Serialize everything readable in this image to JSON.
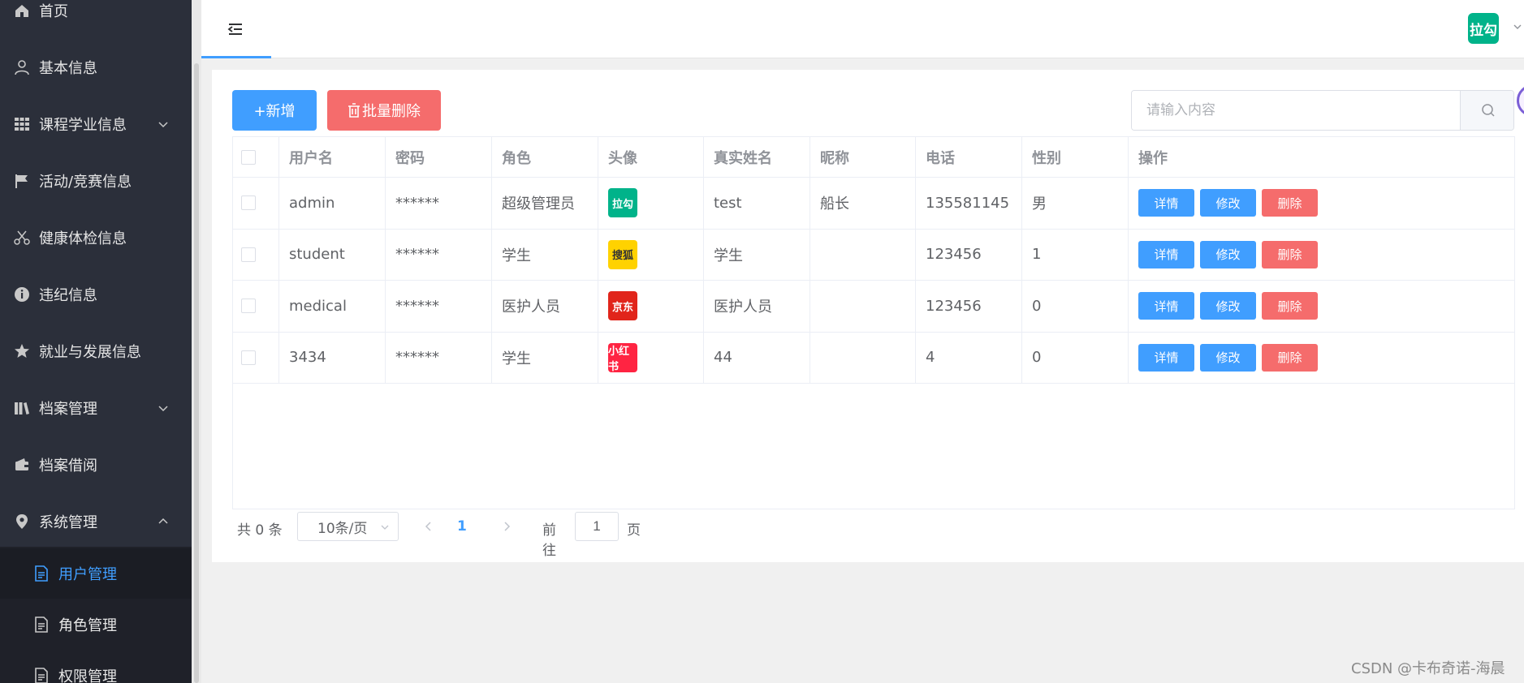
{
  "sidebar": {
    "items": [
      {
        "label": "首页"
      },
      {
        "label": "基本信息"
      },
      {
        "label": "课程学业信息"
      },
      {
        "label": "活动/竞赛信息"
      },
      {
        "label": "健康体检信息"
      },
      {
        "label": "违纪信息"
      },
      {
        "label": "就业与发展信息"
      },
      {
        "label": "档案管理"
      },
      {
        "label": "档案借阅"
      },
      {
        "label": "系统管理"
      }
    ],
    "subitems": [
      {
        "label": "用户管理"
      },
      {
        "label": "角色管理"
      },
      {
        "label": "权限管理"
      }
    ]
  },
  "header": {
    "avatar_text": "拉勾"
  },
  "toolbar": {
    "add_label": "+新增",
    "batch_delete_label": "批量删除",
    "search_placeholder": "请输入内容"
  },
  "table": {
    "columns": [
      "用户名",
      "密码",
      "角色",
      "头像",
      "真实姓名",
      "昵称",
      "电话",
      "性别",
      "操作"
    ],
    "rows": [
      {
        "username": "admin",
        "password": "******",
        "role": "超级管理员",
        "avatar_text": "拉勾",
        "avatar_color": "#00b38a",
        "realname": "test",
        "nickname": "船长",
        "phone": "135581145",
        "gender": "男"
      },
      {
        "username": "student",
        "password": "******",
        "role": "学生",
        "avatar_text": "搜狐",
        "avatar_color": "#ffd200",
        "realname": "学生",
        "nickname": "",
        "phone": "123456",
        "gender": "1"
      },
      {
        "username": "medical",
        "password": "******",
        "role": "医护人员",
        "avatar_text": "京东",
        "avatar_color": "#e1251b",
        "realname": "医护人员",
        "nickname": "",
        "phone": "123456",
        "gender": "0"
      },
      {
        "username": "3434",
        "password": "******",
        "role": "学生",
        "avatar_text": "小红书",
        "avatar_color": "#ff2442",
        "realname": "44",
        "nickname": "",
        "phone": "4",
        "gender": "0"
      }
    ],
    "actions": {
      "detail": "详情",
      "edit": "修改",
      "delete": "删除"
    }
  },
  "pagination": {
    "total": "共 0 条",
    "page_size": "10条/页",
    "current_page": "1",
    "goto_label": "前往",
    "goto_value": "1",
    "page_suffix": "页"
  },
  "watermark": "CSDN @卡布奇诺-海晨",
  "colors": {
    "primary": "#409eff",
    "danger": "#f56c6c",
    "sidebar_bg": "#2b2f3a"
  }
}
